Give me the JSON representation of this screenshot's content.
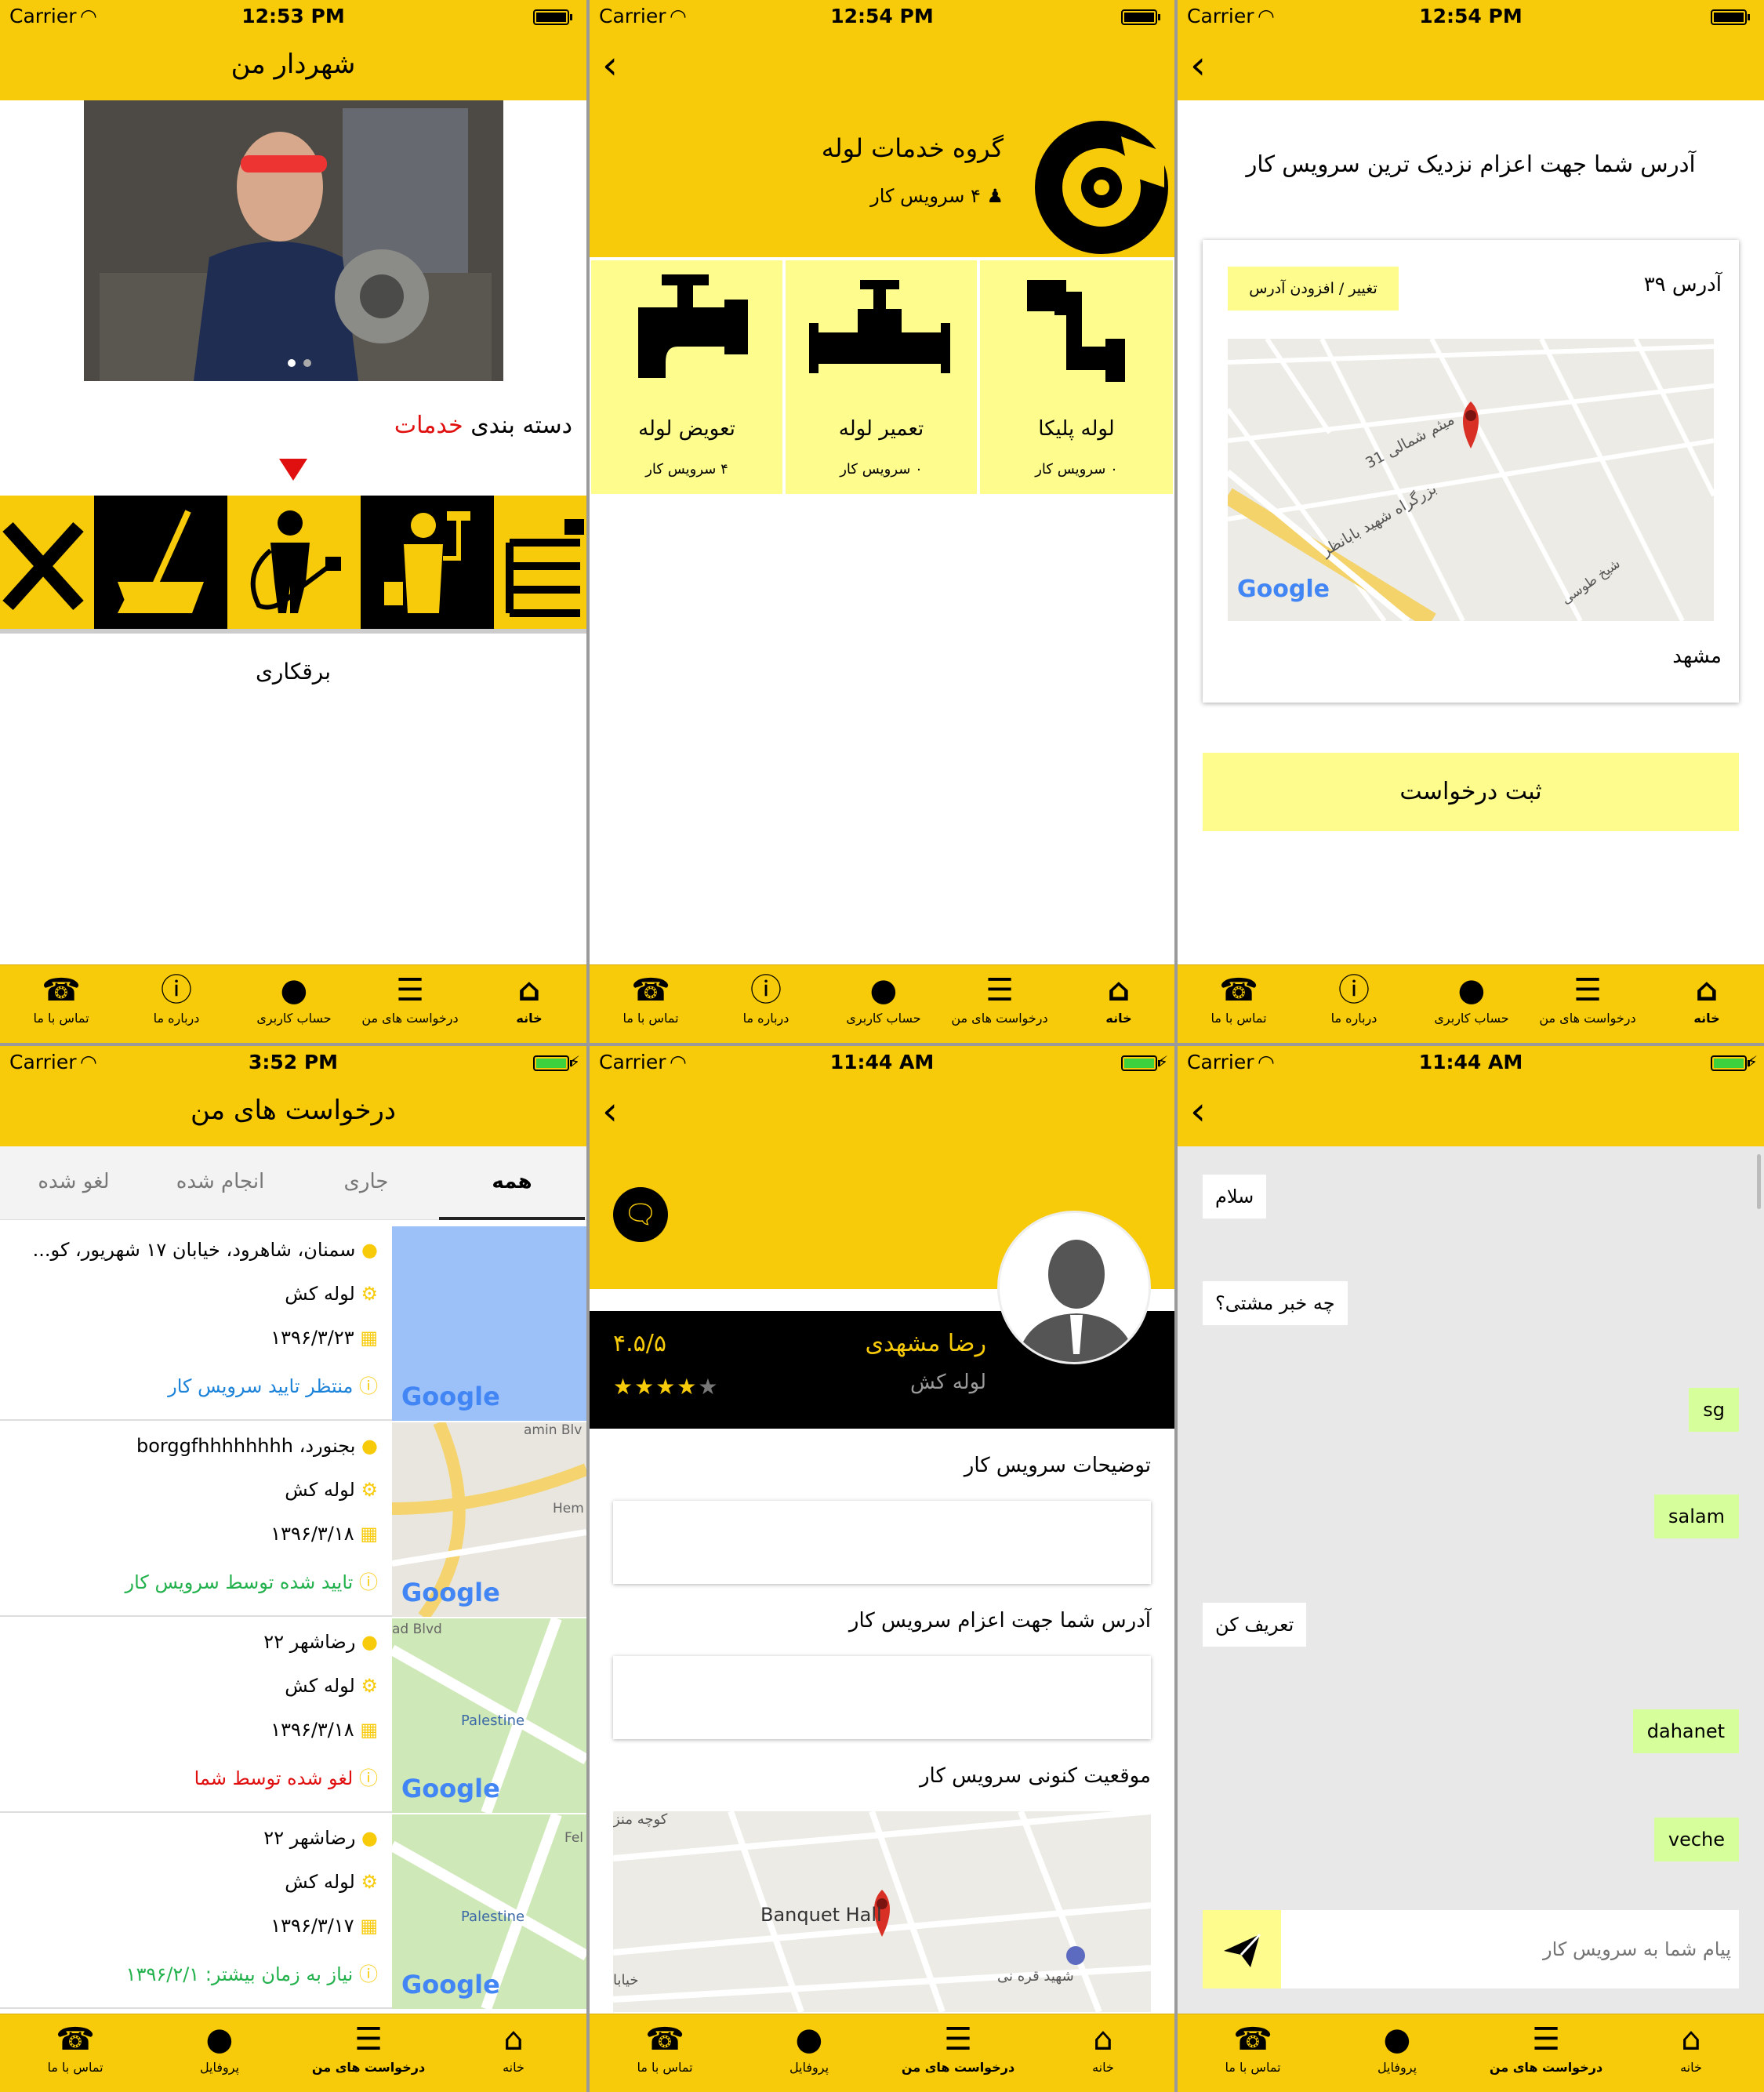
{
  "colors": {
    "primary": "#f8cb0a",
    "light_yellow": "#fffc8e",
    "red": "#e01010",
    "blue": "#1d83d8",
    "green": "#22b14c",
    "black": "#000000"
  },
  "status1": {
    "carrier": "Carrier",
    "time": "12:53 PM"
  },
  "status2": {
    "carrier": "Carrier",
    "time": "12:54 PM"
  },
  "status3": {
    "carrier": "Carrier",
    "time": "12:54 PM"
  },
  "status4": {
    "carrier": "Carrier",
    "time": "3:52 PM"
  },
  "status5": {
    "carrier": "Carrier",
    "time": "11:44 AM"
  },
  "status6": {
    "carrier": "Carrier",
    "time": "11:44 AM"
  },
  "tabs_a": [
    {
      "icon": "phone-icon",
      "label": "تماس با ما"
    },
    {
      "icon": "info-icon",
      "label": "درباره ما"
    },
    {
      "icon": "user-icon",
      "label": "حساب کاربری"
    },
    {
      "icon": "list-icon",
      "label": "درخواست های من"
    },
    {
      "icon": "home-icon",
      "label": "خانه"
    }
  ],
  "tabs_b": [
    {
      "icon": "phone-icon",
      "label": "تماس با ما"
    },
    {
      "icon": "user-icon",
      "label": "پروفایل"
    },
    {
      "icon": "list-icon",
      "label": "درخواست های من"
    },
    {
      "icon": "home-icon",
      "label": "خانه"
    }
  ],
  "home": {
    "title": "شهردار من",
    "category_prefix": "دسته بندی",
    "category_highlight": "خدمات",
    "selected_category": "برقکاری"
  },
  "group": {
    "title": "گروه خدمات لوله",
    "count": "۴ سرویس کار",
    "items": [
      {
        "name": "تعویض لوله",
        "count": "۴ سرویس کار"
      },
      {
        "name": "تعمیر لوله",
        "count": "۰ سرویس کار"
      },
      {
        "name": "لوله پلیکا",
        "count": "۰ سرویس کار"
      }
    ]
  },
  "address": {
    "heading": "آدرس شما جهت اعزام نزدیک ترین سرویس کار",
    "change_button": "تغییر / افزودن آدرس",
    "address_name": "آدرس ۳۹",
    "city": "مشهد",
    "submit": "ثبت درخواست",
    "map_streets": [
      "میثم شمالی 31",
      "بزرگراه شهید بابانظر",
      "شیخ طوسی"
    ],
    "map_brand": "Google"
  },
  "requests": {
    "title": "درخواست های من",
    "tabs": [
      "همه",
      "جاری",
      "انجام شده",
      "لغو شده"
    ],
    "items": [
      {
        "address": "سمنان، شاهرود، خیابان ۱۷ شهریور، کو...",
        "service": "لوله کش",
        "date": "۱۳۹۶/۳/۲۳",
        "status": "منتظر تایید سرویس کار",
        "status_color": "#1d83d8"
      },
      {
        "address": "بجنورد، borggfhhhhhhhh",
        "service": "لوله کش",
        "date": "۱۳۹۶/۳/۱۸",
        "status": "تایید شده توسط سرویس کار",
        "status_color": "#22b14c"
      },
      {
        "address": "رضاشهر ۲۲",
        "service": "لوله کش",
        "date": "۱۳۹۶/۳/۱۸",
        "status": "لغو شده توسط شما",
        "status_color": "#e01010"
      },
      {
        "address": "رضاشهر ۲۲",
        "service": "لوله کش",
        "date": "۱۳۹۶/۳/۱۷",
        "status": "نیاز به زمان بیشتر: ۱۳۹۶/۲/۱",
        "status_color": "#22b14c"
      }
    ],
    "map_labels": [
      "amin Blv",
      "Hem",
      "ad Blvd",
      "Palestine",
      "Fel"
    ],
    "map_brand": "Google"
  },
  "profile": {
    "name": "رضا مشهدی",
    "role": "لوله کش",
    "rating": "۴.۵/۵",
    "stars": 4.5,
    "desc_label": "توضیحات سرویس کار",
    "address_label": "آدرس شما جهت اعزام سرویس کار",
    "location_label": "موقعیت کنونی سرویس کار",
    "map_poi": "Banquet Hall",
    "map_streets": [
      "کوچه منز",
      "شهید قره نی",
      "خیابا"
    ]
  },
  "chat": {
    "messages": [
      {
        "text": "سلام",
        "mine": false
      },
      {
        "text": "چه خبر مشتی؟",
        "mine": false
      },
      {
        "text": "sg",
        "mine": true
      },
      {
        "text": "salam",
        "mine": true
      },
      {
        "text": "تعریف کن",
        "mine": false
      },
      {
        "text": "dahanet",
        "mine": true
      },
      {
        "text": "veche",
        "mine": true
      }
    ],
    "placeholder": "پیام شما به سرویس کار"
  }
}
